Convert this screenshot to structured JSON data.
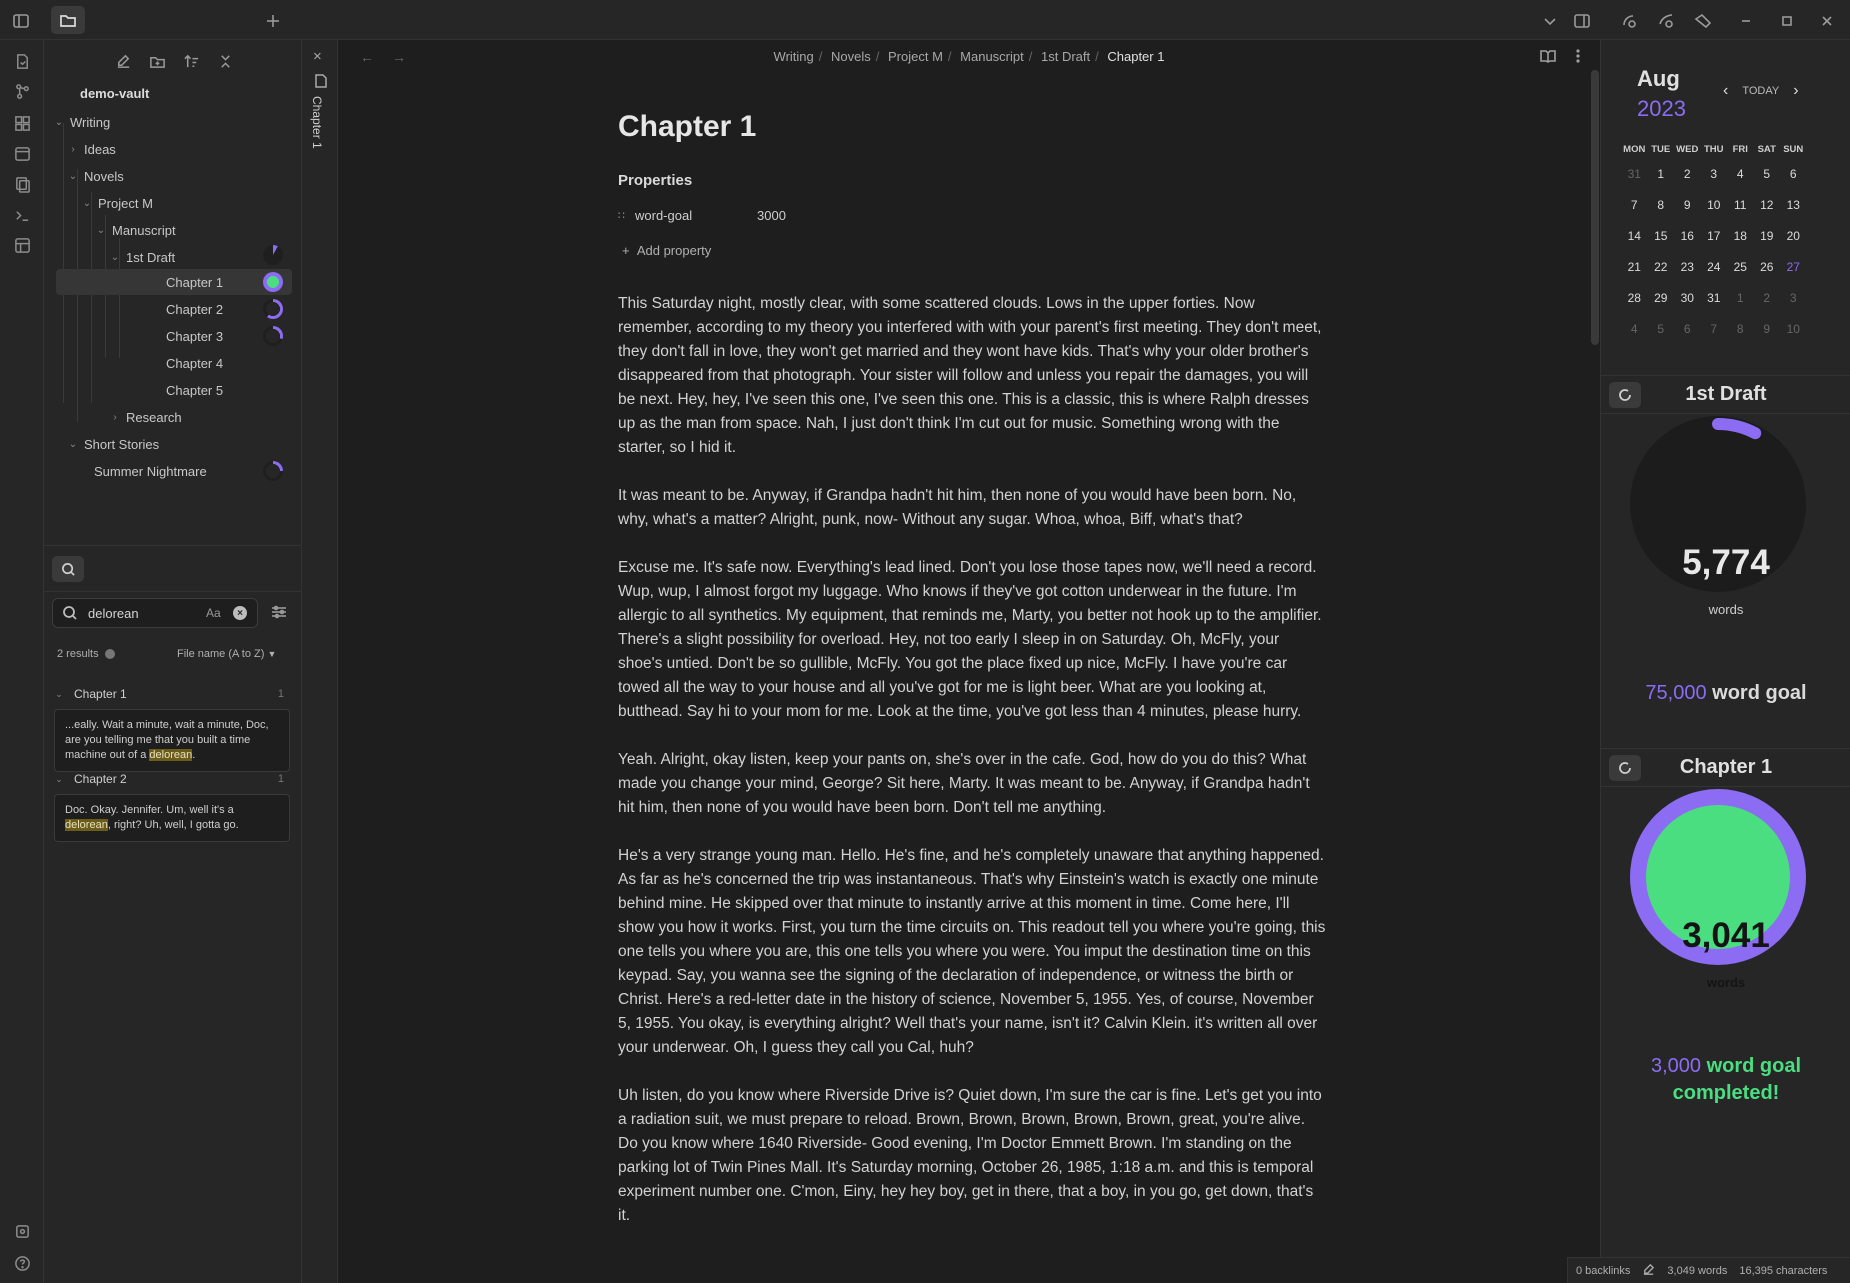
{
  "vault": "demo-vault",
  "tree": {
    "writing": "Writing",
    "ideas": "Ideas",
    "novels": "Novels",
    "project_m": "Project M",
    "manuscript": "Manuscript",
    "first_draft": "1st Draft",
    "chapters": [
      "Chapter 1",
      "Chapter 2",
      "Chapter 3",
      "Chapter 4",
      "Chapter 5"
    ],
    "research": "Research",
    "short_stories": "Short Stories",
    "summer": "Summer Nightmare"
  },
  "search": {
    "value": "delorean",
    "case_toggle": "Aa",
    "results_count": "2 results",
    "sort": "File name (A to Z)",
    "results": [
      {
        "title": "Chapter 1",
        "count": "1",
        "before": "...eally. Wait a minute, wait a minute, Doc, are you telling me that you built a time machine out of a ",
        "match": "delorean",
        "after": "."
      },
      {
        "title": "Chapter 2",
        "count": "1",
        "before": "Doc. Okay. Jennifer. Um, well it's a ",
        "match": "delorean",
        "after": ", right? Uh, well, I gotta go."
      }
    ]
  },
  "tab": {
    "title": "Chapter 1"
  },
  "breadcrumb": [
    "Writing",
    "Novels",
    "Project M",
    "Manuscript",
    "1st Draft",
    "Chapter 1"
  ],
  "doc": {
    "title": "Chapter 1",
    "properties_heading": "Properties",
    "prop_key": "word-goal",
    "prop_value": "3000",
    "add_property": "Add property",
    "paragraphs": [
      "This Saturday night, mostly clear, with some scattered clouds. Lows in the upper forties. Now remember, according to my theory you interfered with with your parent's first meeting. They don't meet, they don't fall in love, they won't get married and they wont have kids. That's why your older brother's disappeared from that photograph. Your sister will follow and unless you repair the damages, you will be next. Hey, hey, I've seen this one, I've seen this one. This is a classic, this is where Ralph dresses up as the man from space. Nah, I just don't think I'm cut out for music. Something wrong with the starter, so I hid it.",
      "It was meant to be. Anyway, if Grandpa hadn't hit him, then none of you would have been born. No, why, what's a matter? Alright, punk, now- Without any sugar. Whoa, whoa, Biff, what's that?",
      "Excuse me. It's safe now. Everything's lead lined. Don't you lose those tapes now, we'll need a record. Wup, wup, I almost forgot my luggage. Who knows if they've got cotton underwear in the future. I'm allergic to all synthetics. My equipment, that reminds me, Marty, you better not hook up to the amplifier. There's a slight possibility for overload. Hey, not too early I sleep in on Saturday. Oh, McFly, your shoe's untied. Don't be so gullible, McFly. You got the place fixed up nice, McFly. I have you're car towed all the way to your house and all you've got for me is light beer. What are you looking at, butthead. Say hi to your mom for me. Look at the time, you've got less than 4 minutes, please hurry.",
      "Yeah. Alright, okay listen, keep your pants on, she's over in the cafe. God, how do you do this? What made you change your mind, George? Sit here, Marty. It was meant to be. Anyway, if Grandpa hadn't hit him, then none of you would have been born. Don't tell me anything.",
      "He's a very strange young man. Hello. He's fine, and he's completely unaware that anything happened. As far as he's concerned the trip was instantaneous. That's why Einstein's watch is exactly one minute behind mine. He skipped over that minute to instantly arrive at this moment in time. Come here, I'll show you how it works. First, you turn the time circuits on. This readout tell you where you're going, this one tells you where you are, this one tells you where you were. You imput the destination time on this keypad. Say, you wanna see the signing of the declaration of independence, or witness the birth or Christ. Here's a red-letter date in the history of science, November 5, 1955. Yes, of course, November 5, 1955. You okay, is everything alright? Well that's your name, isn't it? Calvin Klein. it's written all over your underwear. Oh, I guess they call you Cal, huh?",
      "Uh listen, do you know where Riverside Drive is? Quiet down, I'm sure the car is fine. Let's get you into a radiation suit, we must prepare to reload. Brown, Brown, Brown, Brown, Brown, great, you're alive. Do you know where 1640 Riverside- Good evening, I'm Doctor Emmett Brown. I'm standing on the parking lot of Twin Pines Mall. It's Saturday morning, October 26, 1985, 1:18 a.m. and this is temporal experiment number one. C'mon, Einy, hey hey boy, get in there, that a boy, in you go, get down, that's it."
    ]
  },
  "calendar": {
    "month": "Aug",
    "year": "2023",
    "today_label": "TODAY",
    "weekdays": [
      "MON",
      "TUE",
      "WED",
      "THU",
      "FRI",
      "SAT",
      "SUN"
    ],
    "weeks": [
      [
        "31",
        "1",
        "2",
        "3",
        "4",
        "5",
        "6"
      ],
      [
        "7",
        "8",
        "9",
        "10",
        "11",
        "12",
        "13"
      ],
      [
        "14",
        "15",
        "16",
        "17",
        "18",
        "19",
        "20"
      ],
      [
        "21",
        "22",
        "23",
        "24",
        "25",
        "26",
        "27"
      ],
      [
        "28",
        "29",
        "30",
        "31",
        "1",
        "2",
        "3"
      ],
      [
        "4",
        "5",
        "6",
        "7",
        "8",
        "9",
        "10"
      ]
    ],
    "today": "27"
  },
  "widget1": {
    "title": "1st Draft",
    "count": "5,774",
    "unit": "words",
    "goal_num": "75,000",
    "goal_text": "word goal",
    "progress": 0.077,
    "color": "#8b6cf3"
  },
  "widget2": {
    "title": "Chapter 1",
    "count": "3,041",
    "unit": "words",
    "goal_num": "3,000",
    "goal_text": "word goal",
    "goal_done": "completed!",
    "progress": 1.0
  },
  "status": {
    "backlinks": "0 backlinks",
    "words": "3,049 words",
    "chars": "16,395 characters"
  },
  "colors": {
    "accent": "#8b6cf3",
    "complete": "#4ade80",
    "highlight": "#6b5c1c"
  }
}
